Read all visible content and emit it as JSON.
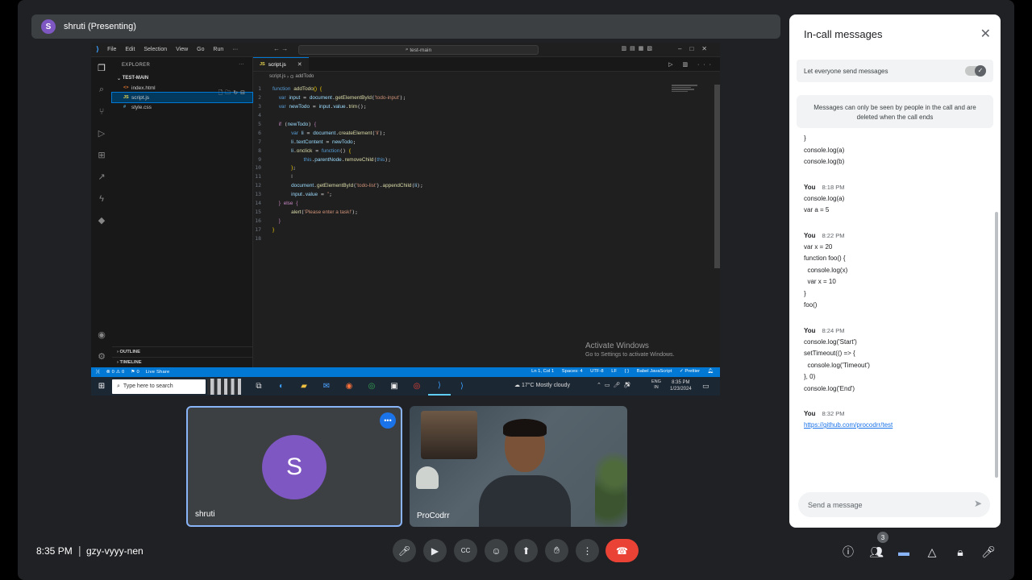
{
  "present_bar": {
    "initial": "S",
    "text": "shruti (Presenting)"
  },
  "vscode": {
    "menu": [
      "File",
      "Edit",
      "Selection",
      "View",
      "Go",
      "Run",
      "···"
    ],
    "search": "test-main",
    "explorer_title": "EXPLORER",
    "folder": "TEST-MAIN",
    "files": [
      {
        "icon": "<>",
        "name": "index.html",
        "color": "#e37933"
      },
      {
        "icon": "JS",
        "name": "script.js",
        "color": "#e8d44d"
      },
      {
        "icon": "#",
        "name": "style.css",
        "color": "#519aba"
      }
    ],
    "outline": "OUTLINE",
    "timeline": "TIMELINE",
    "tab": {
      "icon": "JS",
      "label": "script.js"
    },
    "breadcrumb": [
      "script.js",
      "addTodo"
    ],
    "line_numbers": [
      "1",
      "2",
      "3",
      "4",
      "5",
      "6",
      "7",
      "8",
      "9",
      "10",
      "11",
      "12",
      "13",
      "14",
      "15",
      "16",
      "17",
      "18"
    ],
    "activate_title": "Activate Windows",
    "activate_sub": "Go to Settings to activate Windows.",
    "status_left": [
      "⊗ 0 ⚠ 0",
      "⚑ 0",
      "Live Share"
    ],
    "status_right": [
      "Ln 1, Col 1",
      "Spaces: 4",
      "UTF-8",
      "LF",
      "{ }",
      "Babel JavaScript",
      "✓ Prettier"
    ]
  },
  "taskbar": {
    "search": "Type here to search",
    "weather": "17°C  Mostly cloudy",
    "lang": [
      "ENG",
      "IN"
    ],
    "time": "8:35 PM",
    "date": "1/23/2024"
  },
  "tiles": {
    "shruti": {
      "initial": "S",
      "name": "shruti"
    },
    "procodrr": {
      "name": "ProCodrr"
    }
  },
  "bottom": {
    "time": "8:35 PM",
    "separator": "|",
    "code": "gzy-vyyy-nen",
    "people_count": "3"
  },
  "chat": {
    "title": "In-call messages",
    "toggle_label": "Let everyone send messages",
    "notice": "Messages can only be seen by people in the call and are deleted when the call ends",
    "pre": [
      "}",
      "",
      "console.log(a)",
      "console.log(b)"
    ],
    "groups": [
      {
        "who": "You",
        "time": "8:18 PM",
        "lines": [
          "console.log(a)",
          "var a = 5"
        ]
      },
      {
        "who": "You",
        "time": "8:22 PM",
        "lines": [
          "var x = 20",
          "",
          "function foo() {",
          "  console.log(x)",
          "  var x = 10",
          "}",
          "foo()"
        ]
      },
      {
        "who": "You",
        "time": "8:24 PM",
        "lines": [
          "console.log('Start')",
          "setTimeout(() => {",
          "  console.log('Timeout')",
          "}, 0)",
          "console.log('End')"
        ]
      },
      {
        "who": "You",
        "time": "8:32 PM",
        "link": "https://github.com/procodrr/test"
      }
    ],
    "input_placeholder": "Send a message"
  },
  "colors": {
    "accent": "#8ab4f8",
    "end_call": "#ea4335",
    "avatar": "#7e57c2",
    "vscode_status": "#0078d4"
  }
}
